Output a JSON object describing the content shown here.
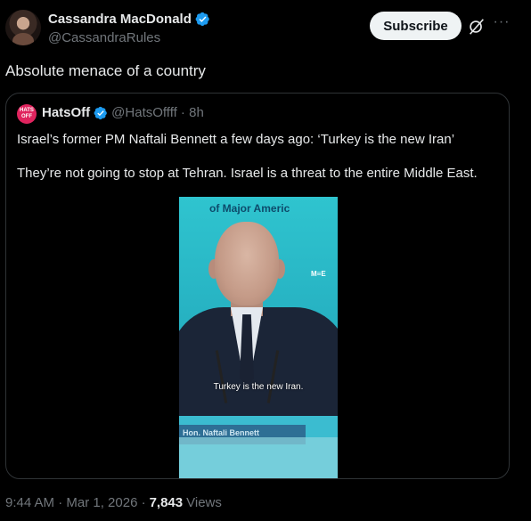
{
  "author": {
    "name": "Cassandra MacDonald",
    "handle": "@CassandraRules",
    "verified_icon": "verified-badge-icon"
  },
  "actions": {
    "subscribe_label": "Subscribe",
    "grok_icon": "grok-icon",
    "more_icon": "more-options-icon",
    "more_glyph": "···"
  },
  "tweet": {
    "text": "Absolute menace of a country"
  },
  "quoted": {
    "avatar_text": "HATS OFF",
    "name": "HatsOff",
    "handle_time": "@HatsOffff · 8h",
    "line1": "Israel’s former PM Naftali Bennett a few days ago: ‘Turkey is the new Iran’",
    "line2": "They’re not going to stop at Tehran. Israel is a threat to the entire Middle East.",
    "video": {
      "banner_text": "of Major Americ",
      "logo_text": "M≡E",
      "caption": "Turkey is the new Iran.",
      "podium_text": "Hon. Naftali Bennett"
    }
  },
  "footer": {
    "time_date": "9:44 AM · Mar 1, 2026 ·",
    "views_count": "7,843",
    "views_label": "Views"
  },
  "colors": {
    "background": "#000000",
    "text_primary": "#e7e9ea",
    "text_secondary": "#71767b",
    "verified_blue": "#1d9bf0",
    "border": "#2f3336"
  }
}
